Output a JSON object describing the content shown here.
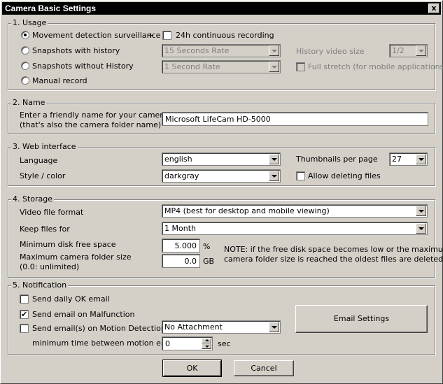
{
  "window": {
    "title": "Camera Basic Settings",
    "close_label": "x"
  },
  "usage": {
    "legend": "1. Usage",
    "options": [
      "Movement detection surveillance",
      "Snapshots with history",
      "Snapshots without History",
      "Manual record"
    ],
    "selected": "Movement detection surveillance",
    "plus": "+",
    "continuous_label": "24h continuous recording",
    "snapshot_rate_history": "15 Seconds Rate",
    "snapshot_rate_nohistory": "1 Second Rate",
    "history_video_size_label": "History video size",
    "history_video_size": "1/2",
    "full_stretch_label": "Full stretch (for mobile applications)"
  },
  "name": {
    "legend": "2. Name",
    "prompt_line1": "Enter a friendly name for your camera",
    "prompt_line2": "(that's also the camera folder name)",
    "value": "Microsoft LifeCam HD-5000"
  },
  "web": {
    "legend": "3. Web interface",
    "language_label": "Language",
    "language": "english",
    "style_label": "Style / color",
    "style": "darkgray",
    "thumbs_label": "Thumbnails per page",
    "thumbs": "27",
    "allow_delete_label": "Allow deleting files"
  },
  "storage": {
    "legend": "4. Storage",
    "format_label": "Video file format",
    "format": "MP4 (best for desktop and mobile viewing)",
    "keep_label": "Keep files for",
    "keep": "1 Month",
    "min_free_label": "Minimum disk free space",
    "min_free": "5.000",
    "min_free_unit": "%",
    "max_folder_label1": "Maximum camera folder size",
    "max_folder_label2": "(0.0: unlimited)",
    "max_folder": "0.0",
    "max_folder_unit": "GB",
    "note_line1": "NOTE: if the free disk space becomes low or the maximum",
    "note_line2": "camera folder size is reached the oldest files are deleted"
  },
  "notification": {
    "legend": "5. Notification",
    "daily_ok_label": "Send daily OK email",
    "daily_ok": false,
    "malfunction_label": "Send email on Malfunction",
    "malfunction": true,
    "motion_label": "Send email(s) on Motion Detection",
    "motion": false,
    "attachment": "No Attachment",
    "min_time_label": "minimum time between motion emails",
    "min_time": "0",
    "min_time_unit": "sec",
    "email_settings_label": "Email Settings"
  },
  "buttons": {
    "ok": "OK",
    "cancel": "Cancel"
  }
}
